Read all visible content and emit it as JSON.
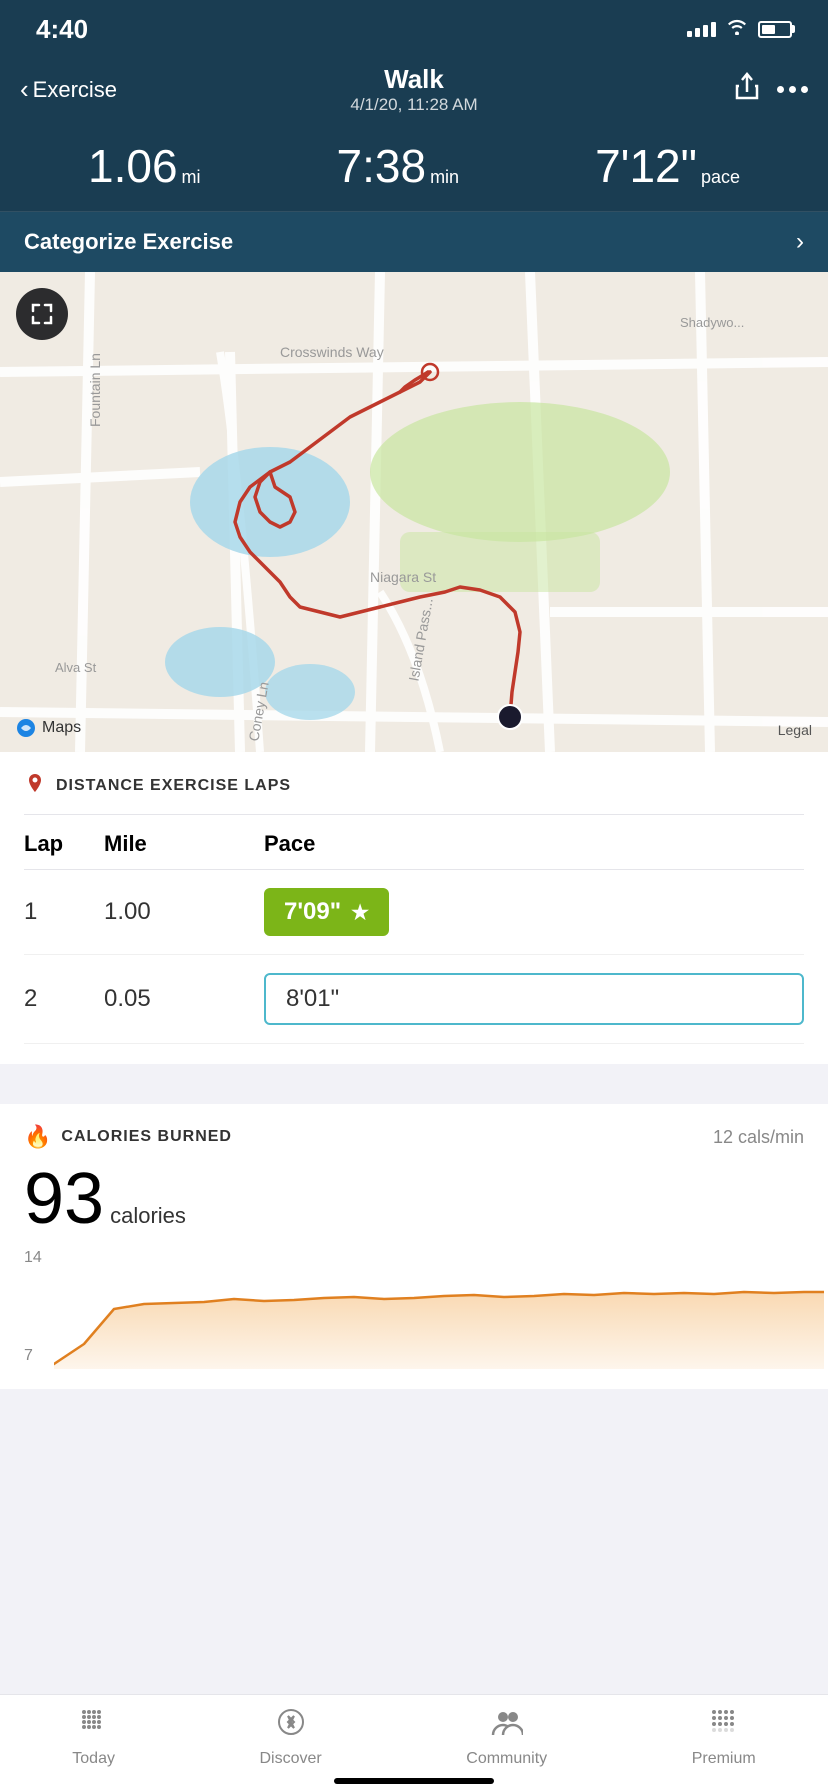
{
  "statusBar": {
    "time": "4:40"
  },
  "header": {
    "backLabel": "Exercise",
    "title": "Walk",
    "subtitle": "4/1/20, 11:28 AM"
  },
  "stats": {
    "distance": {
      "value": "1.06",
      "unit": "mi"
    },
    "duration": {
      "value": "7:38",
      "unit": "min"
    },
    "pace": {
      "value": "7'12\"",
      "unit": "pace"
    }
  },
  "categorize": {
    "label": "Categorize Exercise"
  },
  "laps": {
    "sectionTitle": "DISTANCE EXERCISE LAPS",
    "columns": {
      "lap": "Lap",
      "mile": "Mile",
      "pace": "Pace"
    },
    "rows": [
      {
        "lap": "1",
        "mile": "1.00",
        "pace": "7'09\"",
        "best": true
      },
      {
        "lap": "2",
        "mile": "0.05",
        "pace": "8'01\"",
        "best": false
      }
    ]
  },
  "calories": {
    "sectionTitle": "CALORIES BURNED",
    "rate": "12 cals/min",
    "value": "93",
    "unit": "calories",
    "chartLabels": [
      "14",
      "7"
    ],
    "chartData": [
      0,
      5,
      30,
      55,
      56,
      57,
      60,
      62,
      60,
      61,
      63,
      64,
      62,
      63,
      65,
      66,
      67,
      65,
      66,
      68,
      69,
      68,
      67,
      69,
      70,
      69
    ]
  },
  "nav": {
    "items": [
      {
        "label": "Today",
        "icon": "grid-icon",
        "active": false
      },
      {
        "label": "Discover",
        "icon": "compass-icon",
        "active": false
      },
      {
        "label": "Community",
        "icon": "people-icon",
        "active": false
      },
      {
        "label": "Premium",
        "icon": "premium-icon",
        "active": false
      }
    ]
  }
}
